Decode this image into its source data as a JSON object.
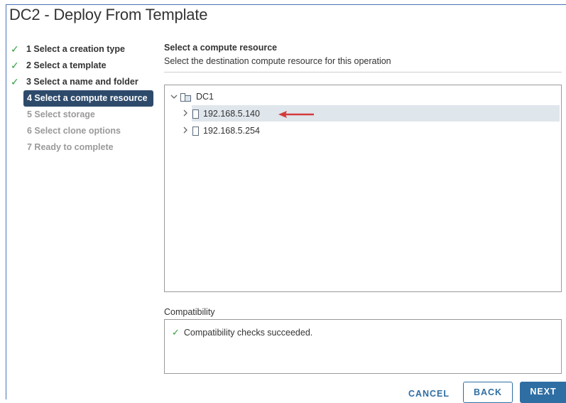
{
  "dialog": {
    "title": "DC2 - Deploy From Template"
  },
  "steps": [
    {
      "label": "1 Select a creation type",
      "state": "done"
    },
    {
      "label": "2 Select a template",
      "state": "done"
    },
    {
      "label": "3 Select a name and folder",
      "state": "done"
    },
    {
      "label": "4 Select a compute resource",
      "state": "active"
    },
    {
      "label": "5 Select storage",
      "state": "future"
    },
    {
      "label": "6 Select clone options",
      "state": "future"
    },
    {
      "label": "7 Ready to complete",
      "state": "future"
    }
  ],
  "check_glyph": "✓",
  "content": {
    "title": "Select a compute resource",
    "description": "Select the destination compute resource for this operation"
  },
  "tree": {
    "root": {
      "label": "DC1",
      "icon": "datacenter-icon",
      "expanded": true
    },
    "hosts": [
      {
        "label": "192.168.5.140",
        "icon": "host-icon",
        "selected": true
      },
      {
        "label": "192.168.5.254",
        "icon": "host-icon",
        "selected": false
      }
    ]
  },
  "compatibility": {
    "label": "Compatibility",
    "message": "Compatibility checks succeeded."
  },
  "buttons": {
    "cancel": "CANCEL",
    "back": "BACK",
    "next": "NEXT"
  },
  "colors": {
    "accent": "#2f6ea3",
    "active_step_bg": "#2e4a6b",
    "success": "#2e9e3c",
    "selection": "#dfe6ec",
    "annotation_arrow": "#d33b3b"
  }
}
